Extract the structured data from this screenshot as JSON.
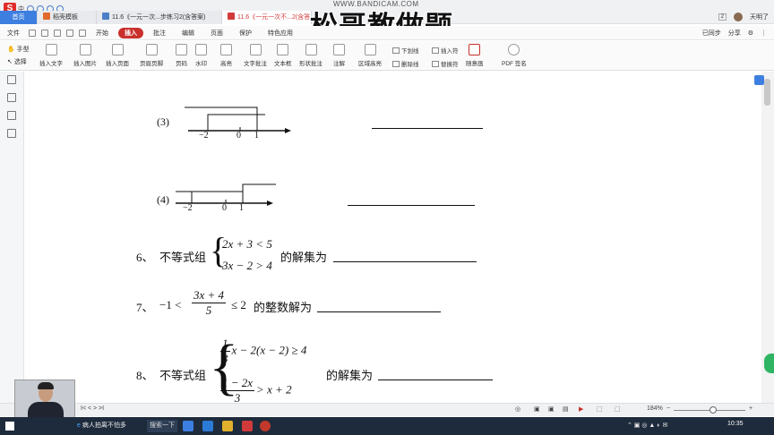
{
  "window": {
    "ime_label": "中",
    "tabs": [
      {
        "label": "首页",
        "kind": "home"
      },
      {
        "label": "稻壳模板",
        "kind": "normal"
      },
      {
        "label": "11.6《一元一次...步练习2(含答案)",
        "kind": "normal"
      },
      {
        "label": "11.6《一元一次不...2(含答",
        "kind": "active"
      }
    ],
    "tab_badge": "2",
    "user_name": "天明了",
    "watermark_url": "WWW.BANDICAM.COM",
    "watermark_text": "松哥教做题"
  },
  "menu": {
    "file_label": "文件",
    "tabs": [
      "开始",
      "插入",
      "批注",
      "编辑",
      "页面",
      "保护",
      "特色应用"
    ],
    "active_tab": "插入",
    "synced": "已同步",
    "share": "分享"
  },
  "ribbon": {
    "hand_tool": "手型",
    "select_tool": "选择",
    "buttons": [
      {
        "label": "插入文字"
      },
      {
        "label": "插入图片"
      },
      {
        "label": "插入页面"
      },
      {
        "label": "页眉页脚"
      },
      {
        "label": "页码"
      },
      {
        "label": "水印"
      },
      {
        "label": "高亮"
      },
      {
        "label": "文字批注"
      },
      {
        "label": "文本框"
      },
      {
        "label": "形状批注"
      },
      {
        "label": "注解"
      },
      {
        "label": "区域高亮"
      }
    ],
    "small": {
      "underline": "下划线",
      "strikethrough": "删除线",
      "insert_char": "插入符",
      "replace_char": "替换符",
      "freehand": "随意画",
      "pdf_sign": "PDF 签名"
    }
  },
  "document": {
    "item3_label": "(3)",
    "item4_label": "(4)",
    "numberline": {
      "t1": "−2",
      "t2": "0",
      "t3": "1"
    },
    "q6": {
      "num": "6、",
      "prefix": "不等式组",
      "line1": "2x + 3 < 5",
      "line2": "3x − 2 > 4",
      "suffix": "的解集为"
    },
    "q7": {
      "num": "7、",
      "lead": "−1 <",
      "numerator": "3x + 4",
      "denominator": "5",
      "tail": "≤ 2",
      "suffix": "的整数解为"
    },
    "q8": {
      "num": "8、",
      "prefix": "不等式组",
      "frac1_num": "1",
      "frac1_den": "3",
      "line1_rest": "x − 2(x − 2) ≥ 4",
      "frac2_num": "1 − 2x",
      "frac2_den": "3",
      "line2_rest": "> x + 2",
      "suffix": "的解集为"
    }
  },
  "statusbar": {
    "page_nav": "I<  <  >  >I",
    "zoom": "184%",
    "zoom_level": 0.55
  },
  "taskbar": {
    "task_item": "病人拍离不怕多",
    "search": "搜索一下",
    "clock": "10:35"
  },
  "colors": {
    "accent_red": "#c9302c",
    "home_tab": "#3d7fe0",
    "taskbar": "#1e2b3c"
  }
}
